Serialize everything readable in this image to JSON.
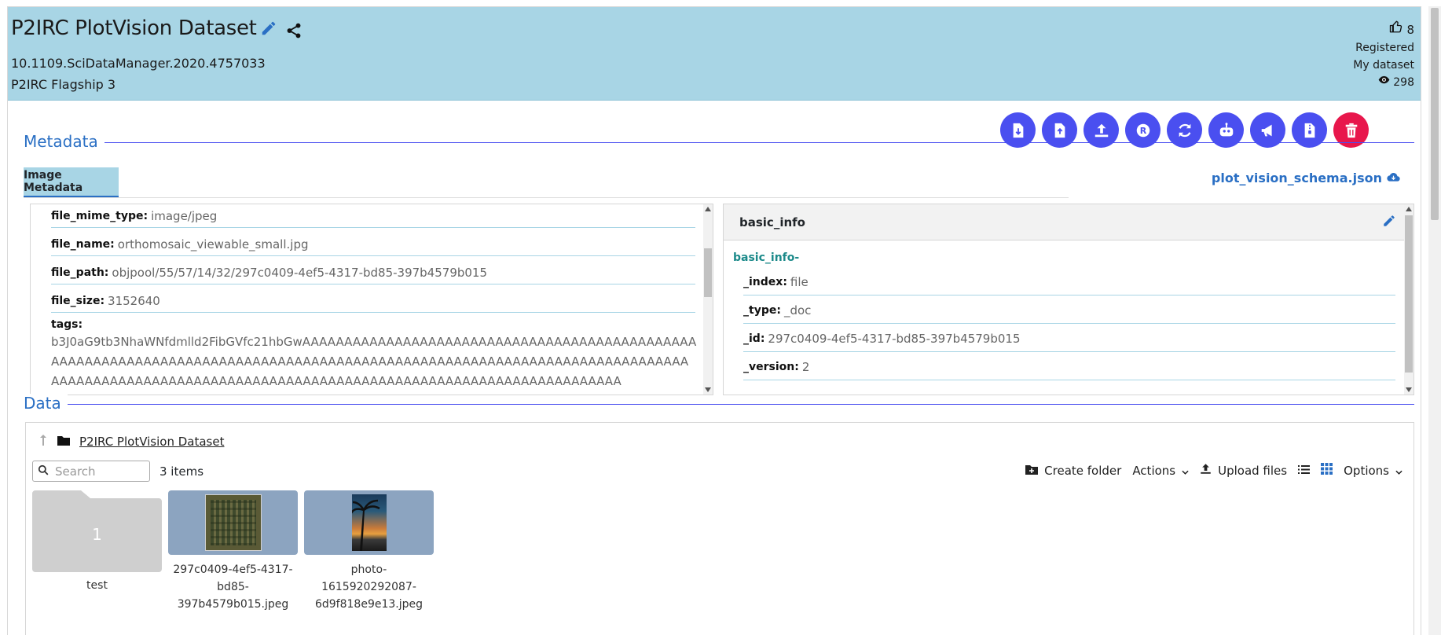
{
  "header": {
    "title": "P2IRC PlotVision Dataset",
    "doi": "10.1109.SciDataManager.2020.4757033",
    "subtitle": "P2IRC Flagship 3",
    "likes": "8",
    "status": "Registered",
    "ownership": "My dataset",
    "views": "298"
  },
  "toolbar": {
    "buttons": [
      "download-file",
      "upload-file",
      "upload",
      "register",
      "refresh",
      "bot",
      "announce",
      "document",
      "delete"
    ]
  },
  "metadata": {
    "section_label": "Metadata",
    "tab_label": "Image Metadata",
    "schema_link": "plot_vision_schema.json",
    "fields": [
      {
        "key": "file_mime_type:",
        "value": "image/jpeg"
      },
      {
        "key": "file_name:",
        "value": "orthomosaic_viewable_small.jpg"
      },
      {
        "key": "file_path:",
        "value": "objpool/55/57/14/32/297c0409-4ef5-4317-bd85-397b4579b015"
      },
      {
        "key": "file_size:",
        "value": "3152640"
      }
    ],
    "tags_key": "tags:",
    "tags_value": "b3J0aG9tb3NhaWNfdmlld2FibGVfc21hbGwAAAAAAAAAAAAAAAAAAAAAAAAAAAAAAAAAAAAAAAAAAAAAAAAAAAAAAAAAAAAAAAAAAAAAAAAAAAAAAAAAAAAAAAAAAAAAAAAAAAAAAAAAAAAAAAAAAAAAAAAAAAAAAAAAAAAAAAAAAAAAAAAAAAAAAAAAAAAAAAAAAAAAAAAAAAAAAAAAAAAAAAAAAAAAAA",
    "basic_info": {
      "title": "basic_info",
      "group_label": "basic_info-",
      "fields": [
        {
          "key": "_index:",
          "value": "file"
        },
        {
          "key": "_type:",
          "value": "_doc"
        },
        {
          "key": "_id:",
          "value": "297c0409-4ef5-4317-bd85-397b4579b015"
        },
        {
          "key": "_version:",
          "value": "2"
        }
      ]
    }
  },
  "data": {
    "section_label": "Data",
    "breadcrumb": "P2IRC PlotVision Dataset",
    "search_placeholder": "Search",
    "item_count": "3 items",
    "create_folder": "Create folder",
    "actions": "Actions",
    "upload_files": "Upload files",
    "options": "Options",
    "items": [
      {
        "name": "test",
        "type": "folder",
        "count": "1"
      },
      {
        "name": "297c0409-4ef5-4317-bd85-397b4579b015.jpeg",
        "line1": "297c0409-4ef5-4317-",
        "line2": "bd85-397b4579b015.jpeg",
        "type": "image"
      },
      {
        "name": "photo-1615920292087-6d9f818e9e13.jpeg",
        "line1": "photo-1615920292087-",
        "line2": "6d9f818e9e13.jpeg",
        "type": "image"
      }
    ]
  },
  "colors": {
    "header_bg": "#a8d5e5",
    "accent": "#4a4ff0",
    "link": "#2a6fc4",
    "danger": "#e8174c",
    "teal": "#1c8a8a"
  }
}
